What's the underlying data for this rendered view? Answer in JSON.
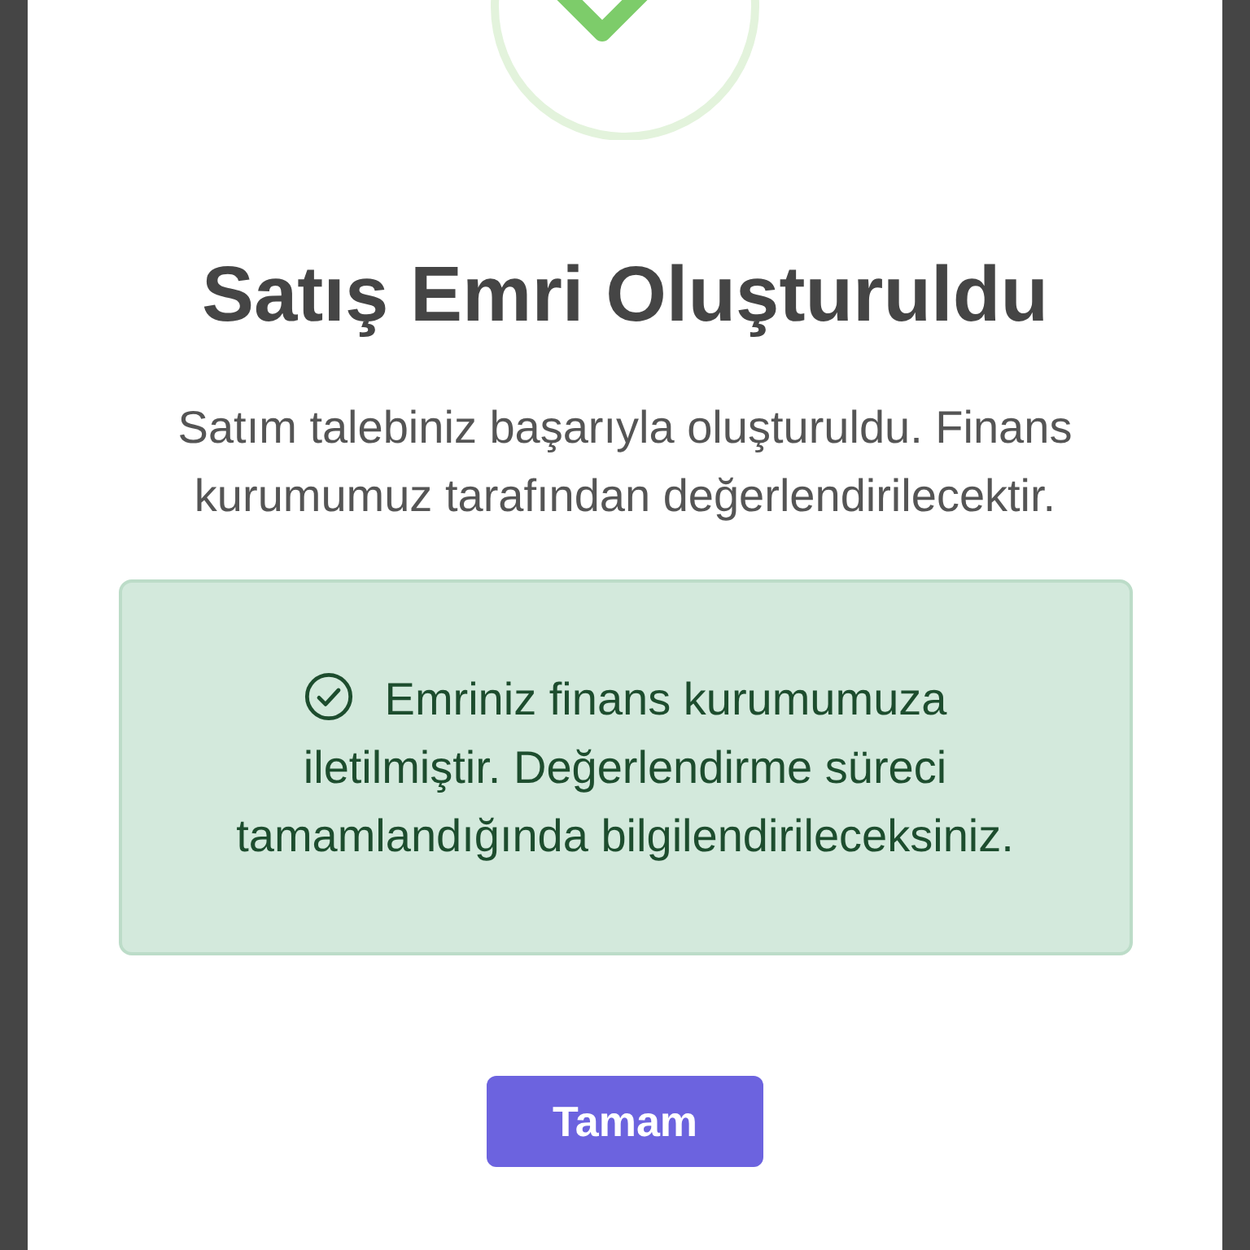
{
  "dialog": {
    "title": "Satış Emri Oluşturuldu",
    "message": "Satım talebiniz başarıyla oluşturuldu. Finans kurumumuz tarafından değerlendirilecektir.",
    "notice": "Emriniz finans kurumumuza iletilmiştir. Değerlendirme süreci tamamlandığında bilgilendirileceksiniz.",
    "button": "Tamam"
  }
}
